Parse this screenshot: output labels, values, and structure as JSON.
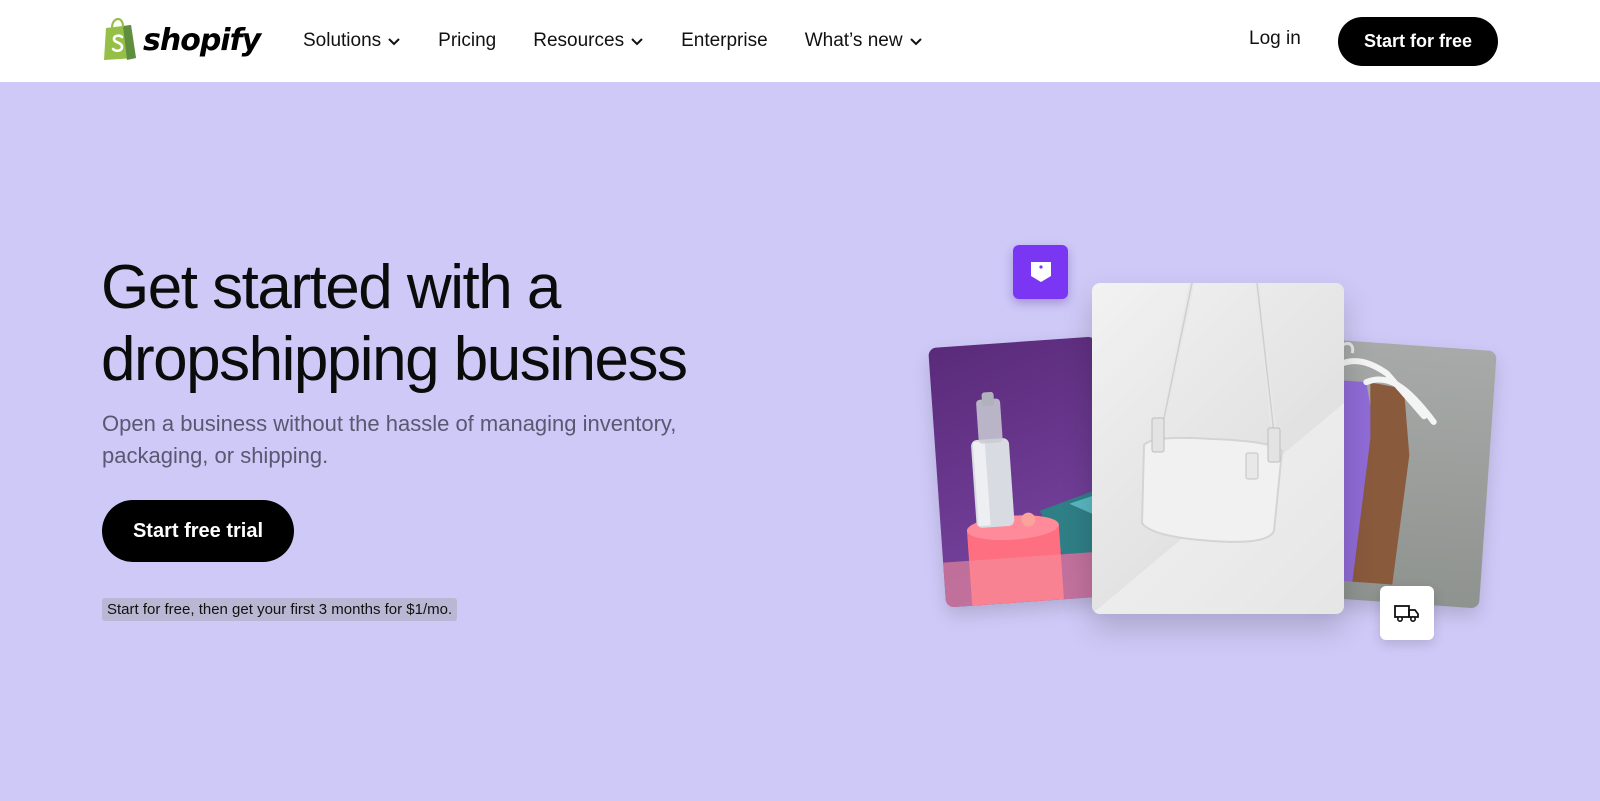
{
  "brand": {
    "name": "shopify",
    "logo_color": "#95bf47"
  },
  "nav": {
    "items": [
      {
        "label": "Solutions",
        "has_dropdown": true
      },
      {
        "label": "Pricing",
        "has_dropdown": false
      },
      {
        "label": "Resources",
        "has_dropdown": true
      },
      {
        "label": "Enterprise",
        "has_dropdown": false
      },
      {
        "label": "What’s new",
        "has_dropdown": true
      }
    ],
    "login_label": "Log in",
    "cta_label": "Start for free"
  },
  "hero": {
    "title_line1": "Get started with a",
    "title_line2": "dropshipping business",
    "subtitle": "Open a business without the hassle of managing inventory, packaging, or shipping.",
    "button_label": "Start free trial",
    "note": "Start for free, then get your first 3 months for $1/mo."
  },
  "collage": {
    "images": [
      "serum-bottle-image",
      "white-handbag-image",
      "clothing-hangers-image"
    ],
    "icons": [
      "tag-icon",
      "truck-icon"
    ]
  },
  "colors": {
    "hero_background": "#cfc9f7",
    "primary_button": "#000000",
    "tag_badge": "#7b36f3"
  }
}
